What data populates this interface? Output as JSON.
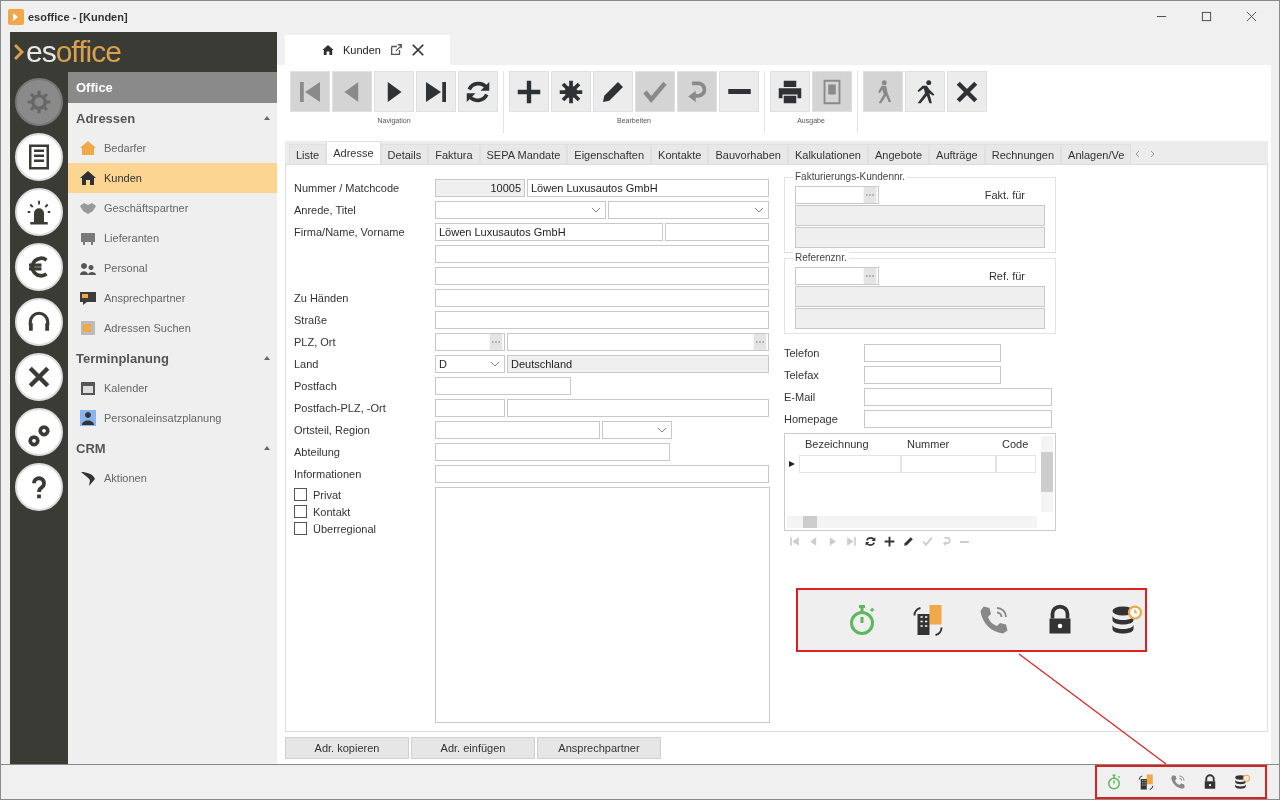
{
  "window": {
    "title": "esoffice - [Kunden]"
  },
  "logo": {
    "prefix": "es",
    "suffix": "office"
  },
  "rail": [
    {
      "selected": true
    },
    {
      "selected": false
    },
    {
      "selected": false
    },
    {
      "selected": false
    },
    {
      "selected": false
    },
    {
      "selected": false
    },
    {
      "selected": false
    },
    {
      "selected": false
    }
  ],
  "nav": {
    "header": "Office",
    "sections": [
      {
        "title": "Adressen",
        "expanded": true,
        "items": [
          {
            "label": "Bedarfer",
            "selected": false
          },
          {
            "label": "Kunden",
            "selected": true
          },
          {
            "label": "Geschäftspartner",
            "selected": false
          },
          {
            "label": "Lieferanten",
            "selected": false
          },
          {
            "label": "Personal",
            "selected": false
          },
          {
            "label": "Ansprechpartner",
            "selected": false
          },
          {
            "label": "Adressen Suchen",
            "selected": false
          }
        ]
      },
      {
        "title": "Terminplanung",
        "expanded": true,
        "items": [
          {
            "label": "Kalender",
            "selected": false
          },
          {
            "label": "Personaleinsatzplanung",
            "selected": false
          }
        ]
      },
      {
        "title": "CRM",
        "expanded": true,
        "items": [
          {
            "label": "Aktionen",
            "selected": false
          }
        ]
      }
    ]
  },
  "doc_tab": {
    "label": "Kunden"
  },
  "toolbar": [
    {
      "label": "Navigation",
      "buttons": [
        {
          "kind": "first",
          "disabled": true
        },
        {
          "kind": "prev",
          "disabled": true
        },
        {
          "kind": "next",
          "disabled": false
        },
        {
          "kind": "last",
          "disabled": false
        },
        {
          "kind": "refresh",
          "disabled": false
        }
      ]
    },
    {
      "label": "Bearbeiten",
      "buttons": [
        {
          "kind": "add",
          "disabled": false
        },
        {
          "kind": "new",
          "disabled": false
        },
        {
          "kind": "edit",
          "disabled": false
        },
        {
          "kind": "save",
          "disabled": true
        },
        {
          "kind": "undo",
          "disabled": true
        },
        {
          "kind": "remove",
          "disabled": false
        }
      ]
    },
    {
      "label": "Ausgabe",
      "buttons": [
        {
          "kind": "print",
          "disabled": false
        },
        {
          "kind": "preview",
          "disabled": true
        }
      ]
    },
    {
      "buttons": [
        {
          "kind": "walk",
          "disabled": true
        },
        {
          "kind": "run",
          "disabled": false
        },
        {
          "kind": "close",
          "disabled": false
        }
      ]
    }
  ],
  "tabs": [
    {
      "label": "Liste",
      "selected": false
    },
    {
      "label": "Adresse",
      "selected": true
    },
    {
      "label": "Details",
      "selected": false
    },
    {
      "label": "Faktura",
      "selected": false
    },
    {
      "label": "SEPA Mandate",
      "selected": false
    },
    {
      "label": "Eigenschaften",
      "selected": false
    },
    {
      "label": "Kontakte",
      "selected": false
    },
    {
      "label": "Bauvorhaben",
      "selected": false
    },
    {
      "label": "Kalkulationen",
      "selected": false
    },
    {
      "label": "Angebote",
      "selected": false
    },
    {
      "label": "Aufträge",
      "selected": false
    },
    {
      "label": "Rechnungen",
      "selected": false
    },
    {
      "label": "Anlagen/Ve",
      "selected": false
    }
  ],
  "form": [
    {
      "label": "Nummer / Matchcode",
      "fields": [
        {
          "kind": "readonly",
          "value": "10005"
        },
        {
          "kind": "text",
          "value": "Löwen Luxusautos GmbH"
        }
      ]
    },
    {
      "label": "Anrede, Titel",
      "fields": [
        {
          "kind": "combo"
        },
        {
          "kind": "combo"
        }
      ]
    },
    {
      "label": "Firma/Name, Vorname",
      "fields": [
        {
          "kind": "text",
          "value": "Löwen Luxusautos GmbH"
        },
        {
          "kind": "text"
        }
      ]
    },
    {
      "fields": [
        {
          "kind": "text"
        }
      ]
    },
    {
      "fields": [
        {
          "kind": "text"
        }
      ]
    },
    {
      "label": "Zu Händen",
      "fields": [
        {
          "kind": "text"
        }
      ]
    },
    {
      "label": "Straße",
      "fields": [
        {
          "kind": "text"
        }
      ]
    },
    {
      "label": "PLZ, Ort",
      "fields": [
        {
          "kind": "lookup"
        },
        {
          "kind": "lookup"
        }
      ]
    },
    {
      "label": "Land",
      "fields": [
        {
          "kind": "combo",
          "value": "D"
        },
        {
          "kind": "readonly",
          "value": "Deutschland"
        }
      ]
    },
    {
      "label": "Postfach",
      "fields": [
        {
          "kind": "text"
        }
      ]
    },
    {
      "label": "Postfach-PLZ, -Ort",
      "fields": [
        {
          "kind": "text"
        },
        {
          "kind": "text"
        }
      ]
    },
    {
      "label": "Ortsteil, Region",
      "fields": [
        {
          "kind": "text"
        },
        {
          "kind": "combo"
        }
      ]
    },
    {
      "label": "Abteilung",
      "fields": [
        {
          "kind": "text"
        }
      ]
    },
    {
      "label": "Informationen",
      "fields": [
        {
          "kind": "text"
        }
      ]
    }
  ],
  "checkboxes": [
    {
      "label": "Privat",
      "checked": false
    },
    {
      "label": "Kontakt",
      "checked": false
    },
    {
      "label": "Überregional",
      "checked": false
    }
  ],
  "groups": [
    {
      "title": "Fakturierungs-Kundennr.",
      "caption": "Fakt. für"
    },
    {
      "title": "Referenznr.",
      "caption": "Ref. für"
    }
  ],
  "contacts": [
    {
      "label": "Telefon"
    },
    {
      "label": "Telefax"
    },
    {
      "label": "E-Mail"
    },
    {
      "label": "Homepage"
    }
  ],
  "grid": {
    "columns": [
      "Bezeichnung",
      "Nummer",
      "Code"
    ]
  },
  "buttons": [
    "Adr. kopieren",
    "Adr. einfügen",
    "Ansprechpartner"
  ]
}
